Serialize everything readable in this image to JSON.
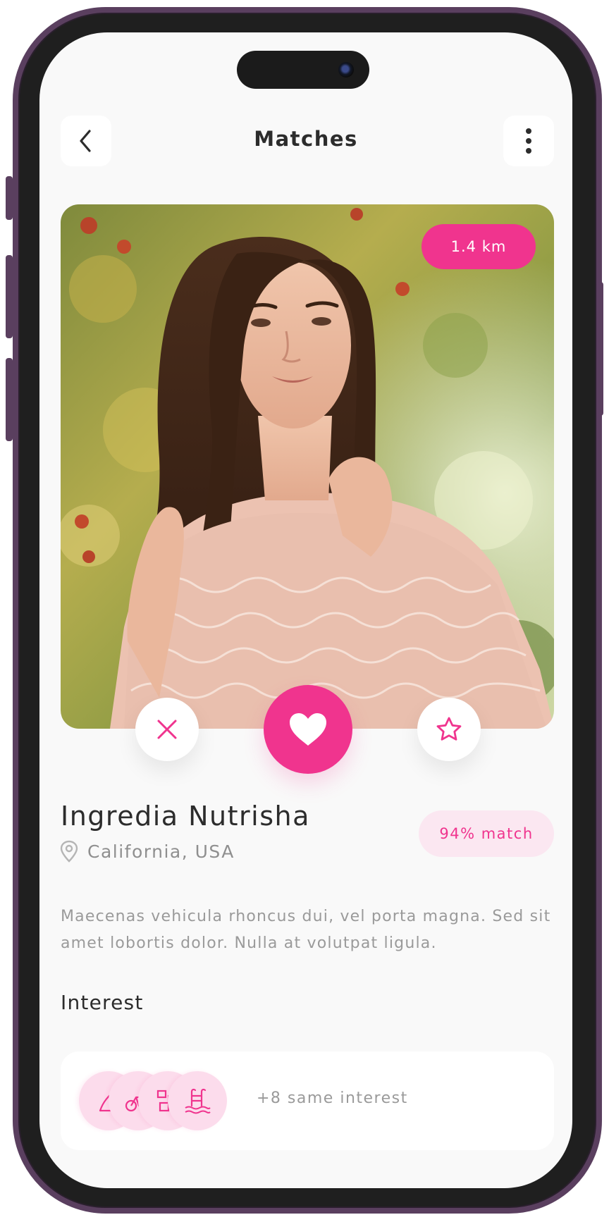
{
  "header": {
    "title": "Matches",
    "back_icon": "chevron-left-icon",
    "menu_icon": "more-vertical-icon"
  },
  "profile": {
    "distance": "1.4 km",
    "name": "Ingredia Nutrisha",
    "location": "California, USA",
    "match": "94% match",
    "bio": "Maecenas vehicula rhoncus dui, vel porta magna. Sed sit amet lobortis dolor. Nulla at volutpat ligula."
  },
  "actions": {
    "reject_icon": "close-icon",
    "like_icon": "heart-icon",
    "favorite_icon": "star-icon"
  },
  "interest": {
    "title": "Interest",
    "summary": "+8 same interest",
    "icons": [
      "sail-icon",
      "bicycle-icon",
      "puzzle-icon",
      "swimming-pool-icon"
    ]
  },
  "colors": {
    "accent": "#f0348e",
    "accent_soft": "#fbe7f1",
    "text_dark": "#2c2c2c",
    "text_muted": "#9a9a9a",
    "background": "#f9f9f9",
    "frame": "#5a3f5f"
  }
}
